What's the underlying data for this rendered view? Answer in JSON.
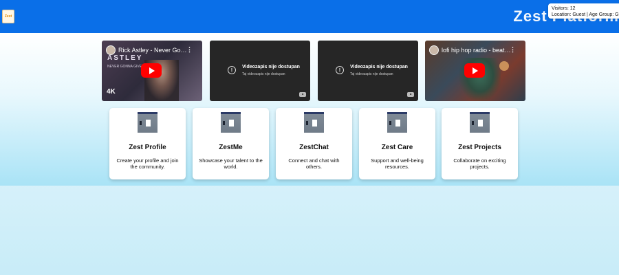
{
  "header": {
    "logo_text": "Zest",
    "ghost_title": "Zest Platform",
    "visitors": "Visitors: 12",
    "location": "Location: Guest | Age Group: Guest"
  },
  "videos": [
    {
      "title": "Rick Astley - Never Gonna Give You Up",
      "lyric_main": "ASTLEY",
      "lyric_sub": "NEVER GONNA GIVE YOU UP",
      "badge": "4K"
    },
    {
      "unavailable_title": "Videozapis nije dostupan",
      "unavailable_sub": "Taj videozapis nije dostupan"
    },
    {
      "unavailable_title": "Videozapis nije dostupan",
      "unavailable_sub": "Taj videozapis nije dostupan"
    },
    {
      "title": "lofi hip hop radio - beats to relax/study to"
    }
  ],
  "cards": [
    {
      "title": "Zest Profile",
      "desc": "Create your profile and join the community."
    },
    {
      "title": "ZestMe",
      "desc": "Showcase your talent to the world."
    },
    {
      "title": "ZestChat",
      "desc": "Connect and chat with others."
    },
    {
      "title": "Zest Care",
      "desc": "Support and well-being resources."
    },
    {
      "title": "Zest Projects",
      "desc": "Collaborate on exciting projects."
    }
  ],
  "colors": {
    "header_bg": "#0a6fe8",
    "play_button": "#ff0000",
    "card_bg": "#ffffff"
  },
  "icons": [
    "zest-logo-icon",
    "youtube-play-icon",
    "kebab-menu-icon",
    "unavailable-icon",
    "youtube-logo-icon",
    "card-thumbnail-icon"
  ]
}
